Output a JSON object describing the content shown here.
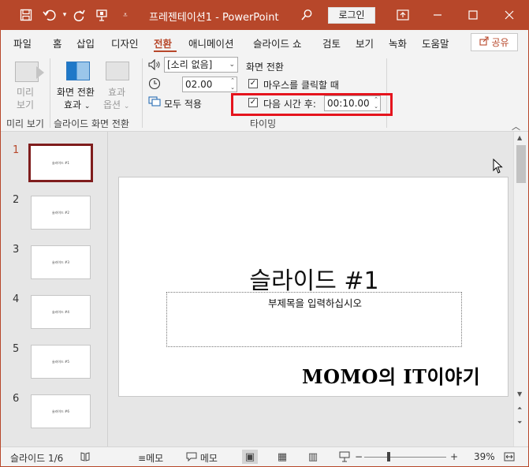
{
  "titlebar": {
    "title": "프레젠테이션1 - PowerPoint",
    "login": "로그인",
    "accent_color": "#b7472a"
  },
  "tabs": [
    "파일",
    "홈",
    "삽입",
    "디자인",
    "전환",
    "애니메이션",
    "슬라이드 쇼",
    "검토",
    "보기",
    "녹화",
    "도움말"
  ],
  "active_tab": "전환",
  "share": "공유",
  "ribbon": {
    "preview": {
      "line1": "미리",
      "line2": "보기",
      "group": "미리 보기"
    },
    "transitions": {
      "current_line1": "화면 전환",
      "current_line2": "효과",
      "options_line1": "효과",
      "options_line2": "옵션",
      "group": "슬라이드 화면 전환"
    },
    "timing": {
      "sound": "[소리 없음]",
      "duration": "02.00",
      "apply_all": "모두 적용",
      "advance_heading": "화면 전환",
      "on_click": "마우스를 클릭할 때",
      "on_click_checked": true,
      "after_label": "다음 시간 후:",
      "after_checked": true,
      "after_value": "00:10.00",
      "group": "타이밍"
    }
  },
  "thumbnails": [
    {
      "num": "1",
      "text": "슬라이드 #1",
      "selected": true
    },
    {
      "num": "2",
      "text": "슬라이드 #2",
      "selected": false
    },
    {
      "num": "3",
      "text": "슬라이드 #3",
      "selected": false
    },
    {
      "num": "4",
      "text": "슬라이드 #4",
      "selected": false
    },
    {
      "num": "5",
      "text": "슬라이드 #5",
      "selected": false
    },
    {
      "num": "6",
      "text": "슬라이드 #6",
      "selected": false
    }
  ],
  "slide": {
    "title": "슬라이드 #1",
    "subtitle": "부제목을 입력하십시오",
    "brand": "MOMO의 IT이야기"
  },
  "statusbar": {
    "slide_info": "슬라이드 1/6",
    "notes": "메모",
    "comments": "메모",
    "zoom": "39%",
    "zoom_level": 39
  }
}
